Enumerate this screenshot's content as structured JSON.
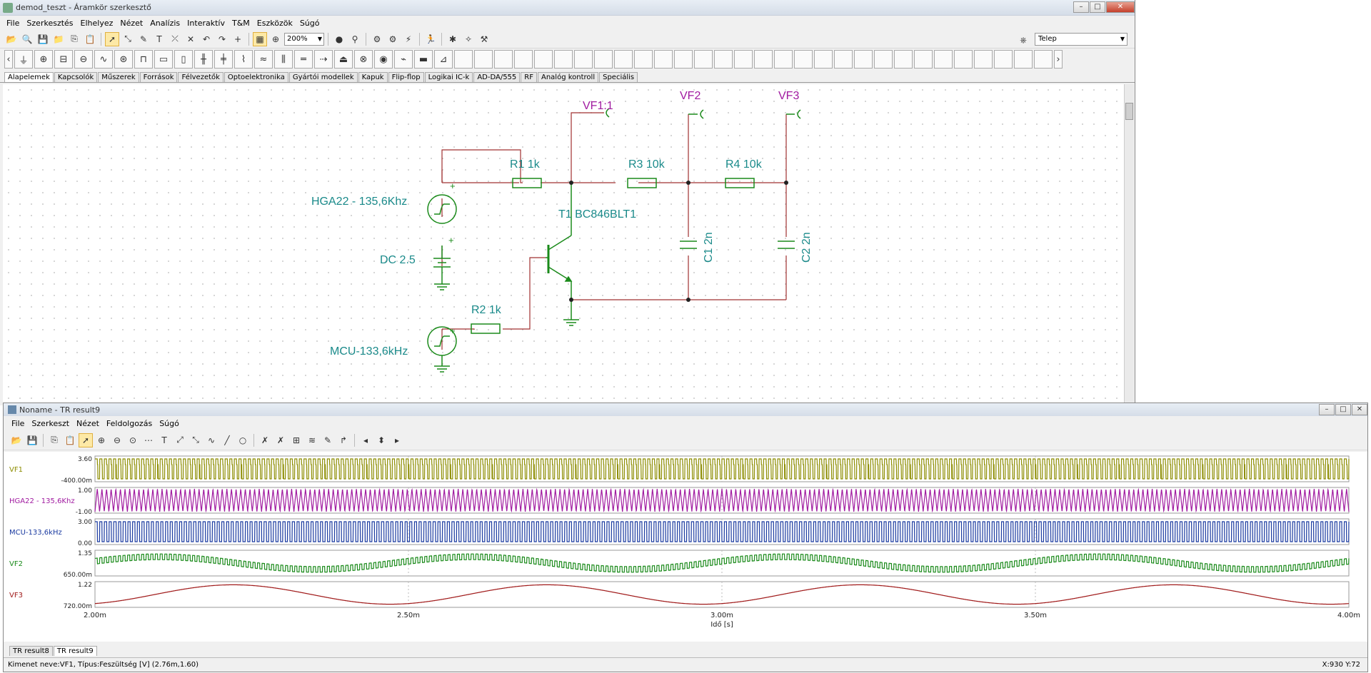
{
  "main_window": {
    "title": "demod_teszt - Áramkör szerkesztő",
    "menu": [
      "File",
      "Szerkesztés",
      "Elhelyez",
      "Nézet",
      "Analízis",
      "Interaktív",
      "T&M",
      "Eszközök",
      "Súgó"
    ],
    "zoom": "200%",
    "place_select": "Telep",
    "component_tabs": [
      "Alapelemek",
      "Kapcsolók",
      "Műszerek",
      "Források",
      "Félvezetők",
      "Optoelektronika",
      "Gyártói modellek",
      "Kapuk",
      "Flip-flop",
      "Logikai IC-k",
      "AD-DA/555",
      "RF",
      "Analóg kontroll",
      "Speciális"
    ],
    "active_tab": "Alapelemek"
  },
  "schematic": {
    "labels": {
      "vf1": "VF1:1",
      "vf2": "VF2",
      "vf3": "VF3",
      "r1": "R1 1k",
      "r2": "R2 1k",
      "r3": "R3 10k",
      "r4": "R4 10k",
      "c1": "C1 2n",
      "c2": "C2 2n",
      "t1": "T1 BC846BLT1",
      "hga": "HGA22 - 135,6Khz",
      "dc": "DC 2.5",
      "mcu": "MCU-133,6kHz"
    }
  },
  "result_window": {
    "title": "Noname - TR result9",
    "menu": [
      "File",
      "Szerkeszt",
      "Nézet",
      "Feldolgozás",
      "Súgó"
    ],
    "tabs": [
      "TR result8",
      "TR result9"
    ],
    "active_tab": "TR result9",
    "status": "Kimenet neve:VF1, Típus:Feszültség [V] (2.76m,1.60)",
    "coords": "X:930  Y:72"
  },
  "chart_data": {
    "type": "line",
    "xlabel": "Idő [s]",
    "x_ticks": [
      "2.00m",
      "2.50m",
      "3.00m",
      "3.50m",
      "4.00m"
    ],
    "xlim": [
      0.002,
      0.004
    ],
    "traces": [
      {
        "name": "VF1",
        "ymax_label": "3.60",
        "ymin_label": "-400.00m",
        "color": "#8c8c00",
        "kind": "fast_square"
      },
      {
        "name": "HGA22 - 135,6Khz",
        "ymax_label": "1.00",
        "ymin_label": "-1.00",
        "color": "#a01aa0",
        "kind": "triangle"
      },
      {
        "name": "MCU-133,6kHz",
        "ymax_label": "3.00",
        "ymin_label": "0.00",
        "color": "#1a3aa0",
        "kind": "square"
      },
      {
        "name": "VF2",
        "ymax_label": "1.35",
        "ymin_label": "650.00m",
        "color": "#1a8a1a",
        "kind": "beat_ripple"
      },
      {
        "name": "VF3",
        "ymax_label": "1.22",
        "ymin_label": "720.00m",
        "color": "#a01a1a",
        "kind": "beat"
      }
    ]
  }
}
